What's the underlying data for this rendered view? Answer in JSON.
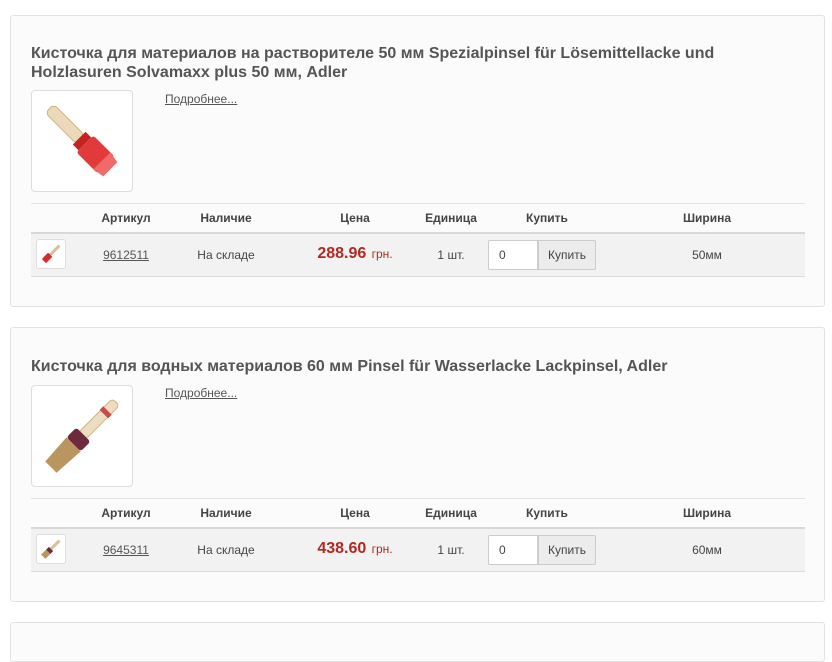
{
  "columns": {
    "article": "Артикул",
    "availability": "Наличие",
    "price": "Цена",
    "unit": "Единица",
    "buy": "Купить",
    "width": "Ширина"
  },
  "products": [
    {
      "title": "Кисточка для материалов на растворителе 50 мм Spezialpinsel für Lösemittellacke und Holzlasuren Solvamaxx plus 50 мм, Adler",
      "more_link": "Подробнее...",
      "image_icon": "paintbrush-red-icon",
      "sku": "9612511",
      "availability": "На складе",
      "price": "288.96",
      "currency": "грн.",
      "unit": "1 шт.",
      "qty_value": "0",
      "buy_label": "Купить",
      "width": "50мм"
    },
    {
      "title": "Кисточка для водных материалов 60 мм Pinsel für Wasserlacke Lackpinsel, Adler",
      "more_link": "Подробнее...",
      "image_icon": "paintbrush-natural-icon",
      "sku": "9645311",
      "availability": "На складе",
      "price": "438.60",
      "currency": "грн.",
      "unit": "1 шт.",
      "qty_value": "0",
      "buy_label": "Купить",
      "width": "60мм"
    }
  ],
  "colors": {
    "price": "#b12a22",
    "card_bg": "#fbfbfb",
    "row_bg": "#f2f2f2"
  }
}
